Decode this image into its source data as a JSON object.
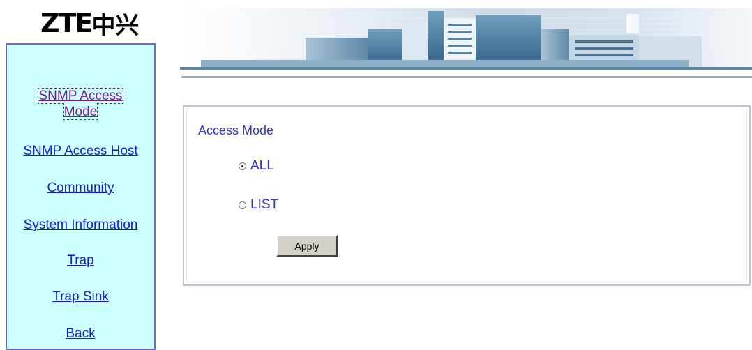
{
  "logo": {
    "latin": "ZTE",
    "chinese": "中兴"
  },
  "sidebar": {
    "items": [
      {
        "label": "SNMP Access Mode",
        "active": true
      },
      {
        "label": "SNMP Access Host"
      },
      {
        "label": "Community"
      },
      {
        "label": "System Information"
      },
      {
        "label": "Trap"
      },
      {
        "label": "Trap Sink"
      },
      {
        "label": "Back"
      }
    ]
  },
  "main": {
    "title": "Access Mode",
    "options": [
      {
        "label": "ALL",
        "selected": true
      },
      {
        "label": "LIST",
        "selected": false
      }
    ],
    "apply_label": "Apply"
  },
  "colors": {
    "sidebar_bg": "#ccffff",
    "sidebar_border": "#6f6ac6",
    "link": "#1a1ad0",
    "visited_link": "#7a1f8a",
    "text_accent": "#3434bb",
    "button_face": "#d4d0c8"
  }
}
